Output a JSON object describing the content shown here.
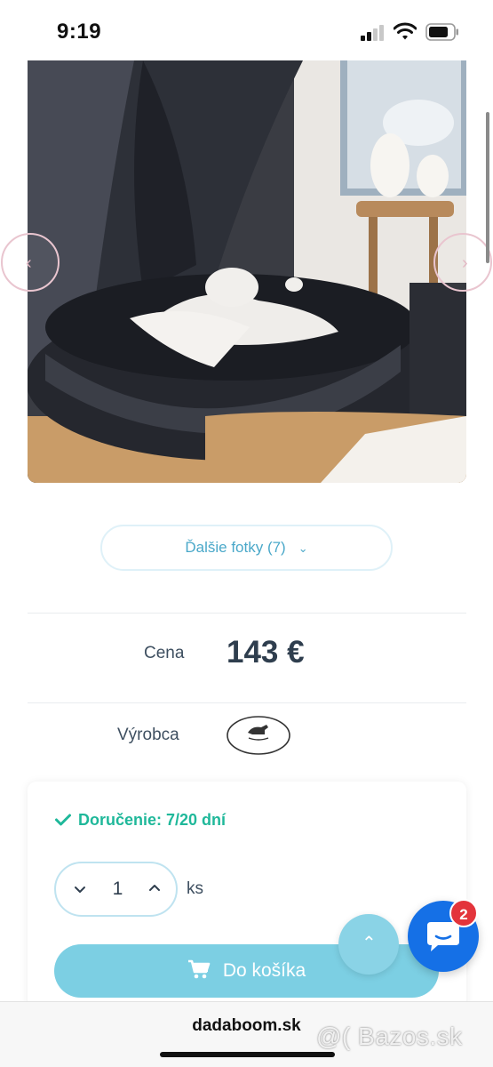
{
  "status_bar": {
    "time": "9:19"
  },
  "gallery": {
    "more_photos_label": "Ďalšie fotky (7)"
  },
  "price": {
    "label": "Cena",
    "value": "143 €"
  },
  "maker": {
    "label": "Výrobca",
    "logo_text": "Cotton & sweets"
  },
  "delivery": {
    "label": "Doručenie: 7/20 dní"
  },
  "cart": {
    "quantity": "1",
    "unit": "ks",
    "add_label": "Do košíka"
  },
  "chat": {
    "badge_count": "2"
  },
  "browser": {
    "url": "dadaboom.sk"
  },
  "watermark": {
    "text": "@( Bazos.sk"
  },
  "colors": {
    "accent": "#7ccfe3",
    "delivery_green": "#1fb89a",
    "chat_blue": "#1570e6",
    "badge_red": "#e3343b"
  }
}
